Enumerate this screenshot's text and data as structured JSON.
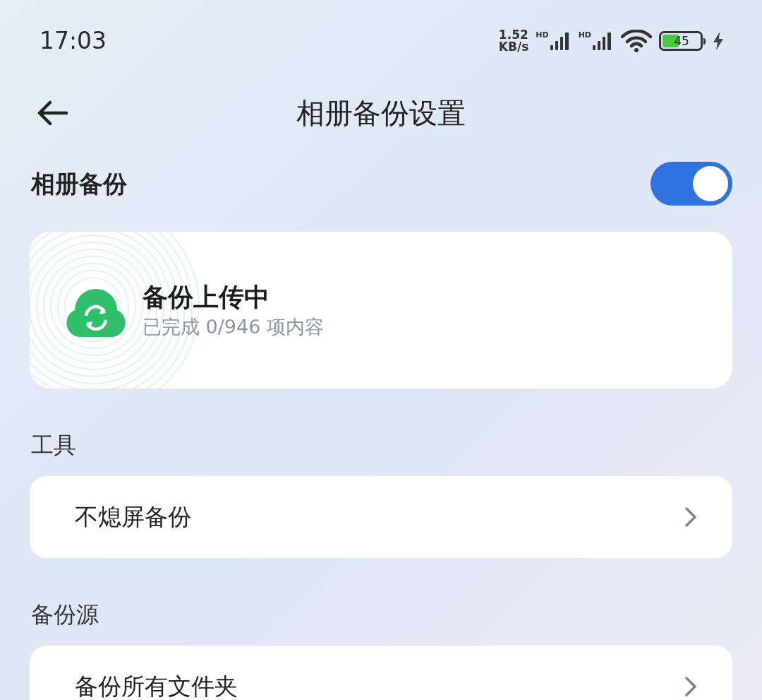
{
  "status_bar": {
    "time": "17:03",
    "net_speed_value": "1.52",
    "net_speed_unit": "KB/s",
    "sim_labels": [
      "HD",
      "HD"
    ],
    "battery": "45",
    "charging": true
  },
  "header": {
    "title": "相册备份设置"
  },
  "backup_toggle": {
    "label": "相册备份",
    "on": true
  },
  "status_card": {
    "title": "备份上传中",
    "subtitle": "已完成 0/946 项内容"
  },
  "sections": [
    {
      "heading": "工具",
      "items": [
        {
          "label": "不熄屏备份"
        }
      ]
    },
    {
      "heading": "备份源",
      "items": [
        {
          "label": "备份所有文件夹"
        }
      ]
    }
  ]
}
